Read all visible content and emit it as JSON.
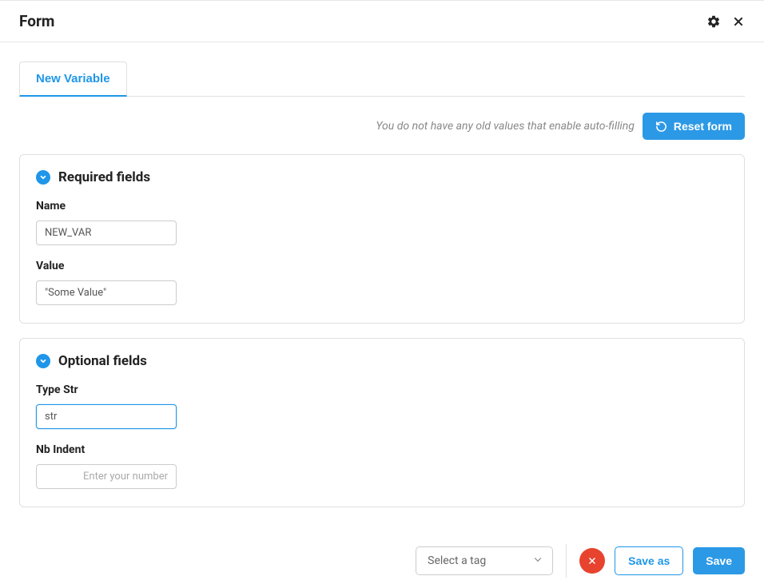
{
  "header": {
    "title": "Form"
  },
  "tabs": {
    "active": "New Variable"
  },
  "reset": {
    "hint": "You do not have any old values that enable auto-filling",
    "button": "Reset form"
  },
  "required": {
    "title": "Required fields",
    "name": {
      "label": "Name",
      "value": "NEW_VAR"
    },
    "value": {
      "label": "Value",
      "value": "\"Some Value\""
    }
  },
  "optional": {
    "title": "Optional fields",
    "typeStr": {
      "label": "Type Str",
      "value": "str"
    },
    "nbIndent": {
      "label": "Nb Indent",
      "placeholder": "Enter your number",
      "value": ""
    }
  },
  "footer": {
    "tagSelect": {
      "placeholder": "Select a tag"
    },
    "saveAs": "Save as",
    "save": "Save"
  }
}
